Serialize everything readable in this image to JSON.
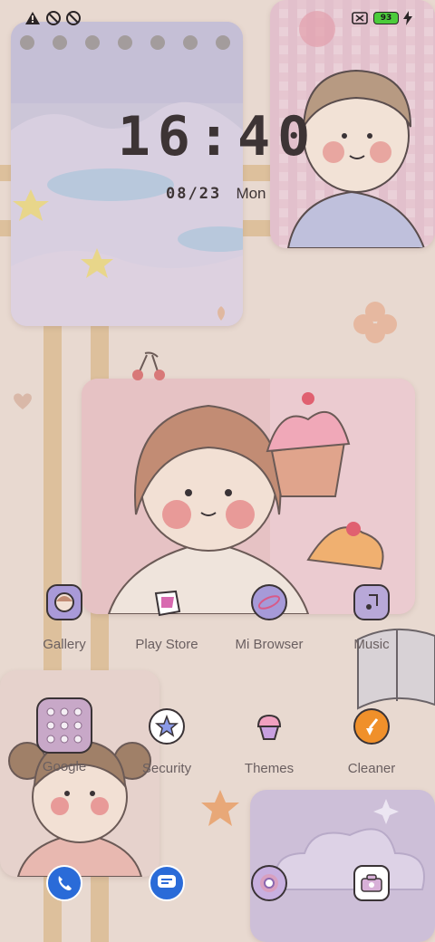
{
  "status": {
    "battery": "93",
    "icons": [
      "warning-icon",
      "alarm-off-icon",
      "alarm-off-icon",
      "sim-off-icon",
      "battery-icon",
      "charging-icon"
    ]
  },
  "clock": {
    "time": "16:40",
    "date": "08/23",
    "day": "Mon"
  },
  "apps_row1": [
    {
      "label": "Gallery",
      "icon": "gallery-icon"
    },
    {
      "label": "Play Store",
      "icon": "play-store-icon"
    },
    {
      "label": "Mi Browser",
      "icon": "browser-icon"
    },
    {
      "label": "Music",
      "icon": "music-icon"
    }
  ],
  "apps_row2": [
    {
      "label": "Google",
      "icon": "folder-icon"
    },
    {
      "label": "Security",
      "icon": "security-icon"
    },
    {
      "label": "Themes",
      "icon": "themes-icon"
    },
    {
      "label": "Cleaner",
      "icon": "cleaner-icon"
    }
  ],
  "dock": [
    {
      "icon": "phone-icon"
    },
    {
      "icon": "messages-icon"
    },
    {
      "icon": "chrome-icon"
    },
    {
      "icon": "camera-icon"
    }
  ],
  "colors": {
    "background": "#e8d9d0",
    "accent_blue": "#2a6bd8",
    "battery_green": "#4ccc3b",
    "cleaner_orange": "#f0902a"
  }
}
